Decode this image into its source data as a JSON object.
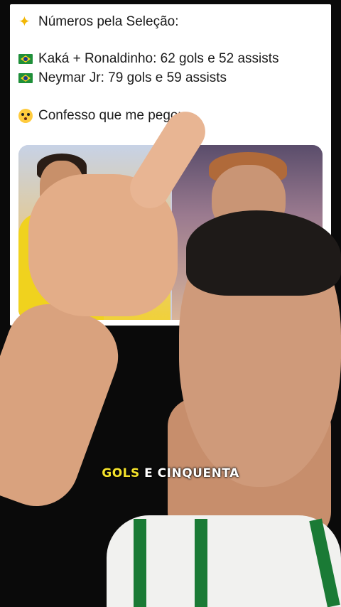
{
  "post": {
    "line1": "Números pela Seleção:",
    "line2": "Kaká + Ronaldinho: 62 gols e 52 assists",
    "line3": "Neymar Jr: 79 gols e 59 assists",
    "line4": "Confesso que me pegou"
  },
  "icons": {
    "star": "glowing-star-icon",
    "flag": "brazil-flag-icon",
    "face": "flushed-face-icon"
  },
  "caption": {
    "highlight": "GOLS",
    "rest": " E CINQUENTA"
  },
  "colors": {
    "caption_highlight": "#f4e22b",
    "caption_text": "#ffffff",
    "jersey_green": "#1a7a35"
  }
}
